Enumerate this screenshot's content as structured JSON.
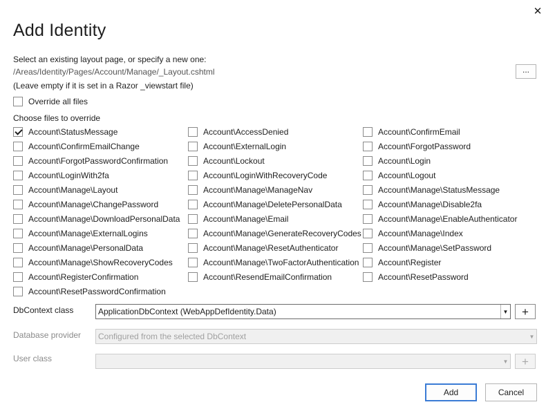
{
  "dialog": {
    "title": "Add Identity",
    "close_icon": "close-icon"
  },
  "layout": {
    "prompt": "Select an existing layout page, or specify a new one:",
    "path": "/Areas/Identity/Pages/Account/Manage/_Layout.cshtml",
    "browse_label": "...",
    "hint": "(Leave empty if it is set in a Razor _viewstart file)"
  },
  "override_all": {
    "label": "Override all files",
    "checked": false
  },
  "choose_label": "Choose files to override",
  "files": [
    {
      "label": "Account\\StatusMessage",
      "checked": true
    },
    {
      "label": "Account\\AccessDenied",
      "checked": false
    },
    {
      "label": "Account\\ConfirmEmail",
      "checked": false
    },
    {
      "label": "Account\\ConfirmEmailChange",
      "checked": false
    },
    {
      "label": "Account\\ExternalLogin",
      "checked": false
    },
    {
      "label": "Account\\ForgotPassword",
      "checked": false
    },
    {
      "label": "Account\\ForgotPasswordConfirmation",
      "checked": false
    },
    {
      "label": "Account\\Lockout",
      "checked": false
    },
    {
      "label": "Account\\Login",
      "checked": false
    },
    {
      "label": "Account\\LoginWith2fa",
      "checked": false
    },
    {
      "label": "Account\\LoginWithRecoveryCode",
      "checked": false
    },
    {
      "label": "Account\\Logout",
      "checked": false
    },
    {
      "label": "Account\\Manage\\Layout",
      "checked": false
    },
    {
      "label": "Account\\Manage\\ManageNav",
      "checked": false
    },
    {
      "label": "Account\\Manage\\StatusMessage",
      "checked": false
    },
    {
      "label": "Account\\Manage\\ChangePassword",
      "checked": false
    },
    {
      "label": "Account\\Manage\\DeletePersonalData",
      "checked": false
    },
    {
      "label": "Account\\Manage\\Disable2fa",
      "checked": false
    },
    {
      "label": "Account\\Manage\\DownloadPersonalData",
      "checked": false
    },
    {
      "label": "Account\\Manage\\Email",
      "checked": false
    },
    {
      "label": "Account\\Manage\\EnableAuthenticator",
      "checked": false
    },
    {
      "label": "Account\\Manage\\ExternalLogins",
      "checked": false
    },
    {
      "label": "Account\\Manage\\GenerateRecoveryCodes",
      "checked": false
    },
    {
      "label": "Account\\Manage\\Index",
      "checked": false
    },
    {
      "label": "Account\\Manage\\PersonalData",
      "checked": false
    },
    {
      "label": "Account\\Manage\\ResetAuthenticator",
      "checked": false
    },
    {
      "label": "Account\\Manage\\SetPassword",
      "checked": false
    },
    {
      "label": "Account\\Manage\\ShowRecoveryCodes",
      "checked": false
    },
    {
      "label": "Account\\Manage\\TwoFactorAuthentication",
      "checked": false
    },
    {
      "label": "Account\\Register",
      "checked": false
    },
    {
      "label": "Account\\RegisterConfirmation",
      "checked": false
    },
    {
      "label": "Account\\ResendEmailConfirmation",
      "checked": false
    },
    {
      "label": "Account\\ResetPassword",
      "checked": false
    },
    {
      "label": "Account\\ResetPasswordConfirmation",
      "checked": false
    }
  ],
  "dbcontext": {
    "label": "DbContext class",
    "value": "ApplicationDbContext (WebAppDefIdentity.Data)",
    "add_label": "+"
  },
  "provider": {
    "label": "Database provider",
    "value": "Configured from the selected DbContext"
  },
  "user_class": {
    "label": "User class",
    "value": "",
    "add_label": "+"
  },
  "buttons": {
    "add": "Add",
    "cancel": "Cancel"
  },
  "colors": {
    "primary_border": "#3a7bd5",
    "disabled_text": "#a0a0a0"
  }
}
